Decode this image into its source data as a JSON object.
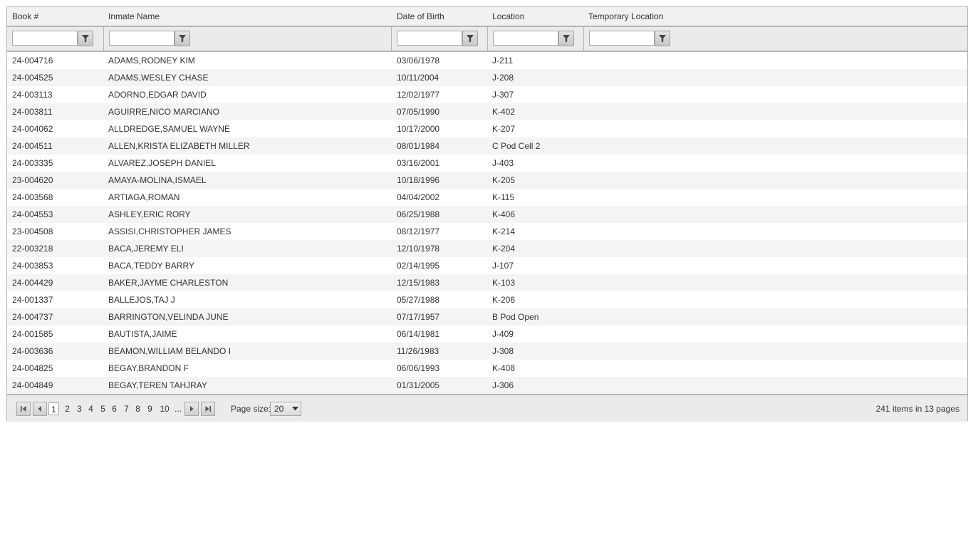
{
  "columns": [
    "Book #",
    "Inmate Name",
    "Date of Birth",
    "Location",
    "Temporary Location"
  ],
  "filters": [
    {
      "value": "",
      "icon": "filter-icon"
    },
    {
      "value": "",
      "icon": "filter-icon"
    },
    {
      "value": "",
      "icon": "filter-icon"
    },
    {
      "value": "",
      "icon": "filter-icon"
    },
    {
      "value": "",
      "icon": "filter-icon"
    }
  ],
  "rows": [
    {
      "book": "24-004716",
      "name": "ADAMS,RODNEY KIM",
      "dob": "03/06/1978",
      "location": "J-211",
      "temp": ""
    },
    {
      "book": "24-004525",
      "name": "ADAMS,WESLEY CHASE",
      "dob": "10/11/2004",
      "location": "J-208",
      "temp": ""
    },
    {
      "book": "24-003113",
      "name": "ADORNO,EDGAR DAVID",
      "dob": "12/02/1977",
      "location": "J-307",
      "temp": ""
    },
    {
      "book": "24-003811",
      "name": "AGUIRRE,NICO MARCIANO",
      "dob": "07/05/1990",
      "location": "K-402",
      "temp": ""
    },
    {
      "book": "24-004062",
      "name": "ALLDREDGE,SAMUEL WAYNE",
      "dob": "10/17/2000",
      "location": "K-207",
      "temp": ""
    },
    {
      "book": "24-004511",
      "name": "ALLEN,KRISTA ELIZABETH MILLER",
      "dob": "08/01/1984",
      "location": "C Pod Cell 2",
      "temp": ""
    },
    {
      "book": "24-003335",
      "name": "ALVAREZ,JOSEPH DANIEL",
      "dob": "03/16/2001",
      "location": "J-403",
      "temp": ""
    },
    {
      "book": "23-004620",
      "name": "AMAYA-MOLINA,ISMAEL",
      "dob": "10/18/1996",
      "location": "K-205",
      "temp": ""
    },
    {
      "book": "24-003568",
      "name": "ARTIAGA,ROMAN",
      "dob": "04/04/2002",
      "location": "K-115",
      "temp": ""
    },
    {
      "book": "24-004553",
      "name": "ASHLEY,ERIC RORY",
      "dob": "06/25/1988",
      "location": "K-406",
      "temp": ""
    },
    {
      "book": "23-004508",
      "name": "ASSISI,CHRISTOPHER JAMES",
      "dob": "08/12/1977",
      "location": "K-214",
      "temp": ""
    },
    {
      "book": "22-003218",
      "name": "BACA,JEREMY ELI",
      "dob": "12/10/1978",
      "location": "K-204",
      "temp": ""
    },
    {
      "book": "24-003853",
      "name": "BACA,TEDDY BARRY",
      "dob": "02/14/1995",
      "location": "J-107",
      "temp": ""
    },
    {
      "book": "24-004429",
      "name": "BAKER,JAYME CHARLESTON",
      "dob": "12/15/1983",
      "location": "K-103",
      "temp": ""
    },
    {
      "book": "24-001337",
      "name": "BALLEJOS,TAJ J",
      "dob": "05/27/1988",
      "location": "K-206",
      "temp": ""
    },
    {
      "book": "24-004737",
      "name": "BARRINGTON,VELINDA JUNE",
      "dob": "07/17/1957",
      "location": "B Pod Open",
      "temp": ""
    },
    {
      "book": "24-001585",
      "name": "BAUTISTA,JAIME",
      "dob": "06/14/1981",
      "location": "J-409",
      "temp": ""
    },
    {
      "book": "24-003636",
      "name": "BEAMON,WILLIAM BELANDO I",
      "dob": "11/26/1983",
      "location": "J-308",
      "temp": ""
    },
    {
      "book": "24-004825",
      "name": "BEGAY,BRANDON F",
      "dob": "06/06/1993",
      "location": "K-408",
      "temp": ""
    },
    {
      "book": "24-004849",
      "name": "BEGAY,TEREN TAHJRAY",
      "dob": "01/31/2005",
      "location": "J-306",
      "temp": ""
    }
  ],
  "pager": {
    "pages": [
      "1",
      "2",
      "3",
      "4",
      "5",
      "6",
      "7",
      "8",
      "9",
      "10",
      "..."
    ],
    "current": "1",
    "page_size_label": "Page size:",
    "page_size": "20",
    "info": "241 items in 13 pages"
  }
}
